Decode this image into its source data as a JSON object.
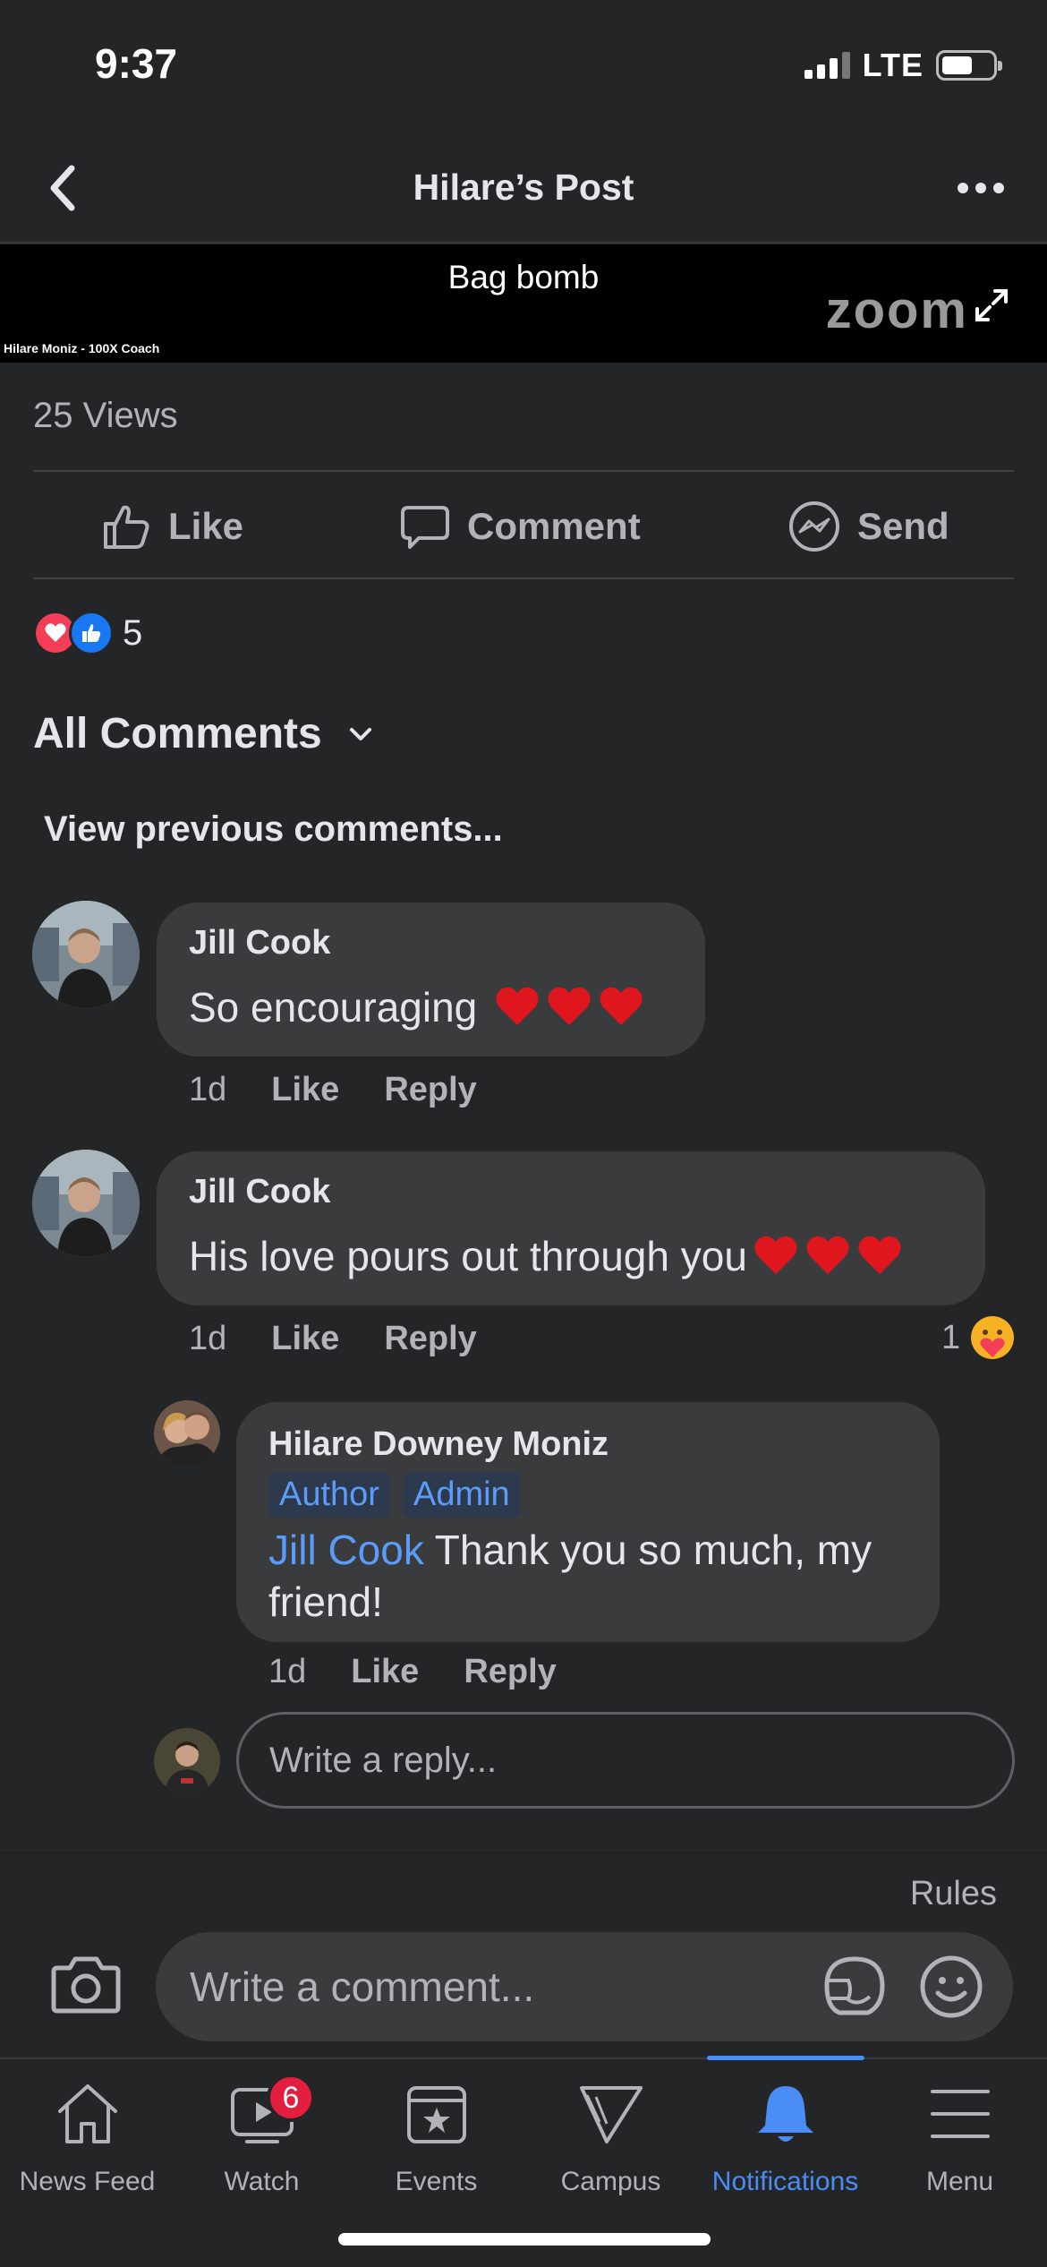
{
  "status_bar": {
    "time": "9:37",
    "network": "LTE"
  },
  "header": {
    "title": "Hilare’s Post"
  },
  "video": {
    "title": "Bag bomb",
    "caption": "Hilare Moniz - 100X Coach",
    "logo_text": "zoom"
  },
  "post": {
    "views": "25 Views",
    "actions": {
      "like": "Like",
      "comment": "Comment",
      "send": "Send"
    },
    "reaction_count": "5"
  },
  "comments_section": {
    "filter_label": "All Comments",
    "view_previous": "View previous comments..."
  },
  "comments": [
    {
      "author": "Jill Cook",
      "text": "So encouraging",
      "time": "1d",
      "like": "Like",
      "reply": "Reply"
    },
    {
      "author": "Jill Cook",
      "text": "His love pours out through you",
      "time": "1d",
      "like": "Like",
      "reply": "Reply",
      "reaction_count": "1"
    }
  ],
  "reply": {
    "author": "Hilare Downey Moniz",
    "badges": [
      "Author",
      "Admin"
    ],
    "mention": "Jill Cook",
    "text_line1": "Thank you so much, my",
    "text_line2": "friend!",
    "time": "1d",
    "like": "Like",
    "reply": "Reply"
  },
  "reply_input": {
    "placeholder": "Write a reply..."
  },
  "composer": {
    "rules": "Rules",
    "placeholder": "Write a comment..."
  },
  "tab_bar": {
    "tabs": [
      {
        "label": "News Feed",
        "icon": "home-icon"
      },
      {
        "label": "Watch",
        "icon": "watch-icon",
        "badge": "6"
      },
      {
        "label": "Events",
        "icon": "events-icon"
      },
      {
        "label": "Campus",
        "icon": "campus-icon"
      },
      {
        "label": "Notifications",
        "icon": "bell-icon",
        "active": true
      },
      {
        "label": "Menu",
        "icon": "menu-icon"
      }
    ]
  },
  "colors": {
    "background": "#242526",
    "bubble": "#3a3b3c",
    "accent": "#4a8ef5",
    "badge_red": "#e41e3f"
  }
}
